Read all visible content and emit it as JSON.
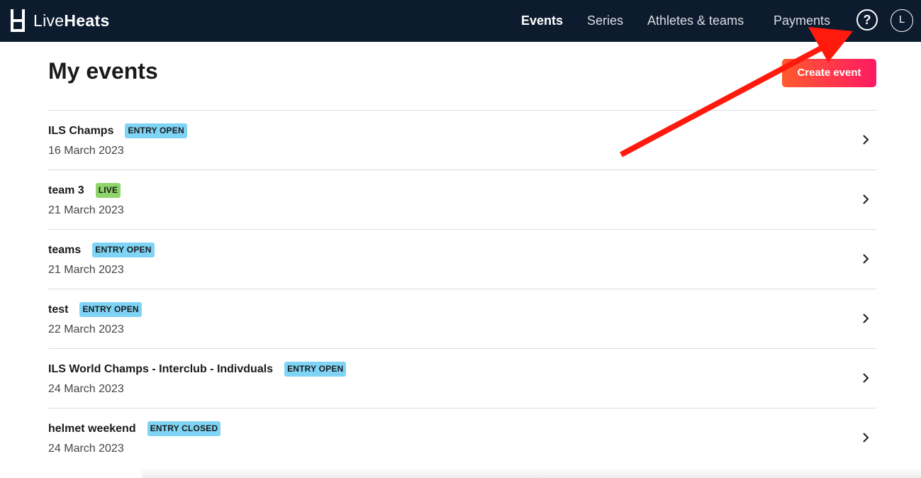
{
  "app": {
    "logo_light": "Live",
    "logo_bold": "Heats"
  },
  "nav": {
    "items": [
      {
        "label": "Events",
        "active": true
      },
      {
        "label": "Series",
        "active": false
      },
      {
        "label": "Athletes & teams",
        "active": false
      },
      {
        "label": "Payments",
        "active": false
      }
    ],
    "help_label": "?",
    "avatar_initial": "L"
  },
  "page": {
    "title": "My events",
    "create_button": "Create event"
  },
  "events": [
    {
      "name": "ILS Champs",
      "badge": "ENTRY OPEN",
      "badge_type": "entry-open",
      "date": "16 March 2023"
    },
    {
      "name": "team 3",
      "badge": "LIVE",
      "badge_type": "live",
      "date": "21 March 2023"
    },
    {
      "name": "teams",
      "badge": "ENTRY OPEN",
      "badge_type": "entry-open",
      "date": "21 March 2023"
    },
    {
      "name": "test",
      "badge": "ENTRY OPEN",
      "badge_type": "entry-open",
      "date": "22 March 2023"
    },
    {
      "name": "ILS World Champs - Interclub - Indivduals",
      "badge": "ENTRY OPEN",
      "badge_type": "entry-open",
      "date": "24 March 2023"
    },
    {
      "name": "helmet weekend",
      "badge": "ENTRY CLOSED",
      "badge_type": "entry-closed",
      "date": "24 March 2023"
    }
  ],
  "colors": {
    "topbar": "#0c1b2e",
    "badge_entry_open": "#7fd4f5",
    "badge_live": "#8fd56a",
    "badge_entry_closed": "#7fd4f5",
    "accent_start": "#ff5a2e",
    "accent_end": "#ff1a63",
    "annotation_arrow": "#ff1a0d"
  },
  "icons": {
    "logo": "liveheats-logo-icon",
    "row_chevron": "chevron-right-icon",
    "annotation": "red-arrow-annotation"
  }
}
